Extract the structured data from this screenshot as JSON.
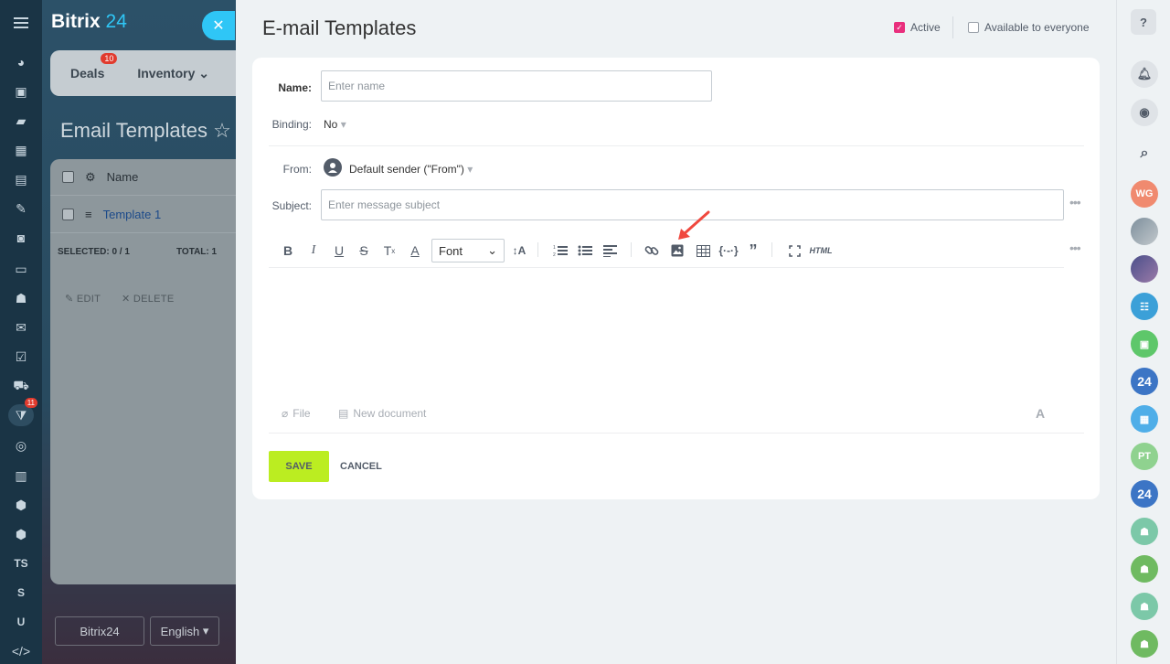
{
  "app": {
    "logo_text": "Bitrix",
    "logo_num": "24"
  },
  "left_rail": {
    "badge": "11",
    "text_items": [
      "TS",
      "S",
      "U"
    ]
  },
  "background": {
    "tabs": {
      "deals": "Deals",
      "deals_badge": "10",
      "inventory": "Inventory"
    },
    "page_title": "Email Templates",
    "list": {
      "header_name": "Name",
      "row_1": "Template 1",
      "selected_label": "SELECTED:",
      "selected_value": "0 / 1",
      "total_label": "TOTAL:",
      "total_value": "1",
      "edit": "EDIT",
      "delete": "DELETE"
    },
    "footer": {
      "logo": "Bitrix24",
      "language": "English"
    }
  },
  "panel": {
    "title": "E-mail Templates",
    "active_label": "Active",
    "active_checked": true,
    "everyone_label": "Available to everyone",
    "everyone_checked": false
  },
  "form": {
    "name_label": "Name:",
    "name_placeholder": "Enter name",
    "binding_label": "Binding:",
    "binding_value": "No",
    "from_label": "From:",
    "from_value": "Default sender (\"From\")",
    "subject_label": "Subject:",
    "subject_placeholder": "Enter message subject",
    "font_select": "Font",
    "html_btn": "HTML",
    "attach_file": "File",
    "attach_new_doc": "New document",
    "save": "SAVE",
    "cancel": "CANCEL"
  },
  "right_rail": {
    "avatars": [
      "WG",
      "PT"
    ],
    "number_icon": "24"
  },
  "colors": {
    "accent_blue": "#2fc6f6",
    "save_green": "#bbed21",
    "active_pink": "#e92f7d",
    "badge_red": "#e13b2e",
    "arrow_red": "#f0483e"
  }
}
